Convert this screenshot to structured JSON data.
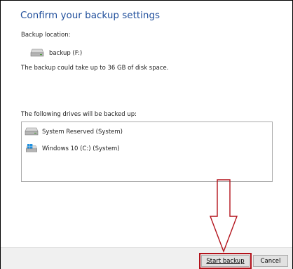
{
  "header": {
    "title": "Confirm your backup settings"
  },
  "backup_location": {
    "label": "Backup location:",
    "drive": {
      "name": "backup (F:)",
      "icon": "drive-icon"
    }
  },
  "space_note": "The backup could take up to 36 GB of disk space.",
  "drives_section": {
    "label": "The following drives will be backed up:",
    "items": [
      {
        "name": "System Reserved (System)",
        "icon": "drive-icon"
      },
      {
        "name": "Windows 10 (C:) (System)",
        "icon": "windows-drive-icon"
      }
    ]
  },
  "footer": {
    "start_label": "Start backup",
    "cancel_label": "Cancel"
  },
  "colors": {
    "title": "#1f4e9b",
    "highlight": "#b3121b",
    "footer_bg": "#f0f0f0"
  }
}
